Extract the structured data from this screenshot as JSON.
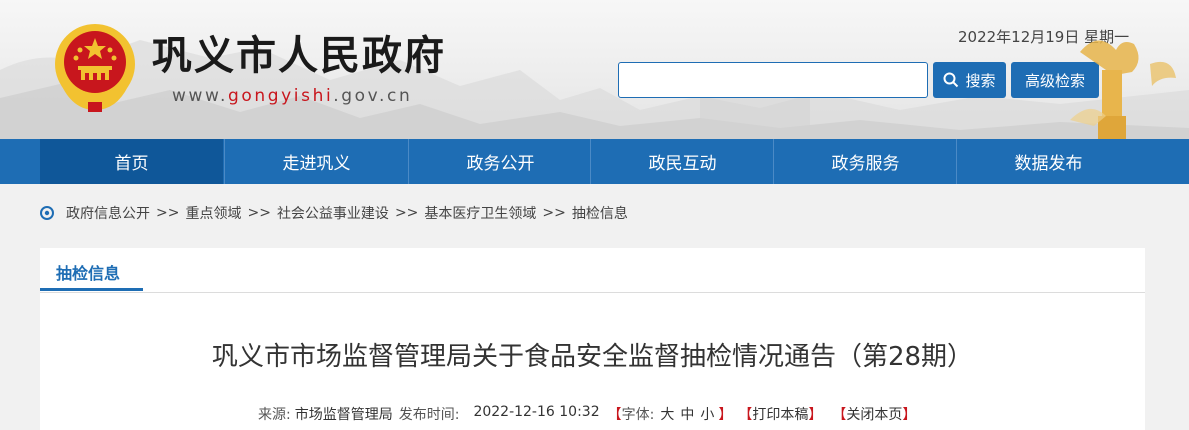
{
  "header": {
    "site_title": "巩义市人民政府",
    "site_url_prefix": "www.",
    "site_url_domain": "gongyishi",
    "site_url_suffix": ".gov.cn",
    "date": "2022年12月19日 星期一",
    "search": {
      "value": "",
      "placeholder": "",
      "button_label": "搜索",
      "advanced_label": "高级检索"
    }
  },
  "nav": {
    "items": [
      "首页",
      "走进巩义",
      "政务公开",
      "政民互动",
      "政务服务",
      "数据发布"
    ],
    "active": "首页"
  },
  "breadcrumb": {
    "items": [
      "政府信息公开",
      "重点领域",
      "社会公益事业建设",
      "基本医疗卫生领域",
      "抽检信息"
    ],
    "separator": ">>"
  },
  "panel": {
    "tab_label": "抽检信息",
    "article_title": "巩义市市场监督管理局关于食品安全监督抽检情况通告（第28期）",
    "meta": {
      "source_label": "来源:",
      "source": "市场监督管理局",
      "publish_label": "发布时间:",
      "publish_time": "2022-12-16 10:32",
      "font_label": "字体:",
      "font_sizes": [
        "大",
        "中",
        "小"
      ],
      "print_label": "打印本稿",
      "close_label": "关闭本页"
    }
  },
  "colors": {
    "brand_blue": "#1e6db4",
    "nav_active": "#0f5799",
    "emblem_red": "#c8161d",
    "gold": "#f2c230"
  }
}
